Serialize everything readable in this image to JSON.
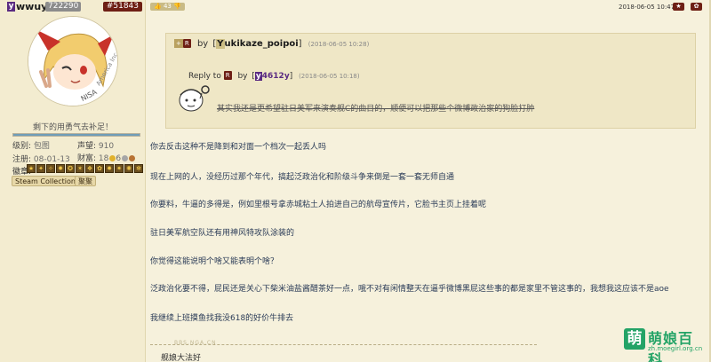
{
  "user": {
    "prefix": "y",
    "name": "wwuyi",
    "uid": "722290",
    "floor": "#51843",
    "signature": "剩下的用勇气去补足！",
    "progress": 1.0,
    "rank_label": "级别:",
    "rank_value": "包图",
    "fame_label": "声望:",
    "fame_value": "910",
    "reg_label": "注册:",
    "reg_value": "08-01-13",
    "wealth_label": "财富:",
    "wealth_value": "18",
    "wealth_coin2": "6",
    "medals_label": "徽章:",
    "medal_icons": [
      "medal-icon",
      "medal-icon",
      "medal-icon",
      "medal-icon",
      "medal-icon",
      "medal-icon",
      "medal-icon",
      "medal-icon",
      "medal-icon",
      "medal-icon",
      "medal-icon",
      "medal-icon"
    ],
    "tag_steam": "Steam Collection",
    "tag_report": "聚聚"
  },
  "post": {
    "likes": "43",
    "date": "2018-06-05 10:47",
    "btn_star": "★",
    "btn_gear": "✿"
  },
  "quote": {
    "badge_plus": "+",
    "badge_r": "R",
    "by": "by",
    "user_init": "Y",
    "user_name": "ukikaze_poipoi",
    "time": "(2018-06-05 10:28)",
    "reply_to": "Reply to",
    "reply_badge": "R",
    "reply_by": "by",
    "reply_user_init": "y",
    "reply_user": "4612y",
    "reply_time": "(2018-06-05 10:18)",
    "text": "其实我还是更希望驻日美军来演奏舰C的曲目的，顺便可以把那些个微博政治家的狗脸打肿"
  },
  "body": {
    "paragraphs": [
      "你去反击这种不是降到和对面一个档次一起丢人吗",
      "现在上网的人，没经历过那个年代，搞起泛政治化和阶级斗争来倒是一套一套无师自通",
      "你要料，牛逼的多得是，例如里根号拿赤城粘土人拍进自己的航母宣传片，它脸书主页上挂着呢",
      "驻日美军航空队还有用神风特攻队涂装的",
      "你觉得这能说明个啥又能表明个啥？",
      "泛政治化要不得，屁民还是关心下柴米油盐酱醋茶好一点，哦不对有闲情整天在逼乎微博黑屁这些事的都是家里不管这事的，我想我这应该不是aoe",
      "我继续上班摸鱼找我没618的好价牛排去"
    ]
  },
  "signature_line": {
    "watermark": "BBS.NGA.CN",
    "text": "舰娘大法好"
  },
  "logo": {
    "mark": "萌",
    "title": "萌娘百科",
    "url": "zh.moegirl.org.cn"
  },
  "colors": {
    "accent_dark_red": "#6e1f14",
    "moegirl_green": "#23a366",
    "page_bg": "#f6f1dc"
  }
}
